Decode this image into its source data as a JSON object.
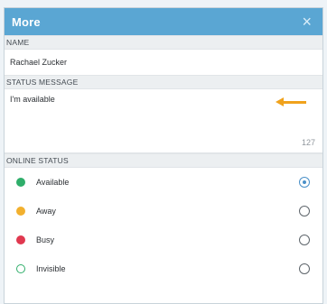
{
  "window": {
    "title": "More",
    "close_glyph": "×"
  },
  "name_section": {
    "header": "NAME",
    "value": "Rachael Zucker"
  },
  "status_section": {
    "header": "STATUS MESSAGE",
    "value": "I'm available",
    "char_count": "127"
  },
  "online_section": {
    "header": "ONLINE STATUS",
    "options": [
      {
        "label": "Available",
        "color": "#2fae6a",
        "selected": true
      },
      {
        "label": "Away",
        "color": "#f2b02e",
        "selected": false
      },
      {
        "label": "Busy",
        "color": "#e0384f",
        "selected": false
      },
      {
        "label": "Invisible",
        "color": "#2fae6a",
        "selected": false,
        "hollow": true
      }
    ]
  },
  "colors": {
    "titlebar": "#5aa6d3",
    "arrow": "#f0a21c",
    "radio_selected": "#4a90c8"
  }
}
